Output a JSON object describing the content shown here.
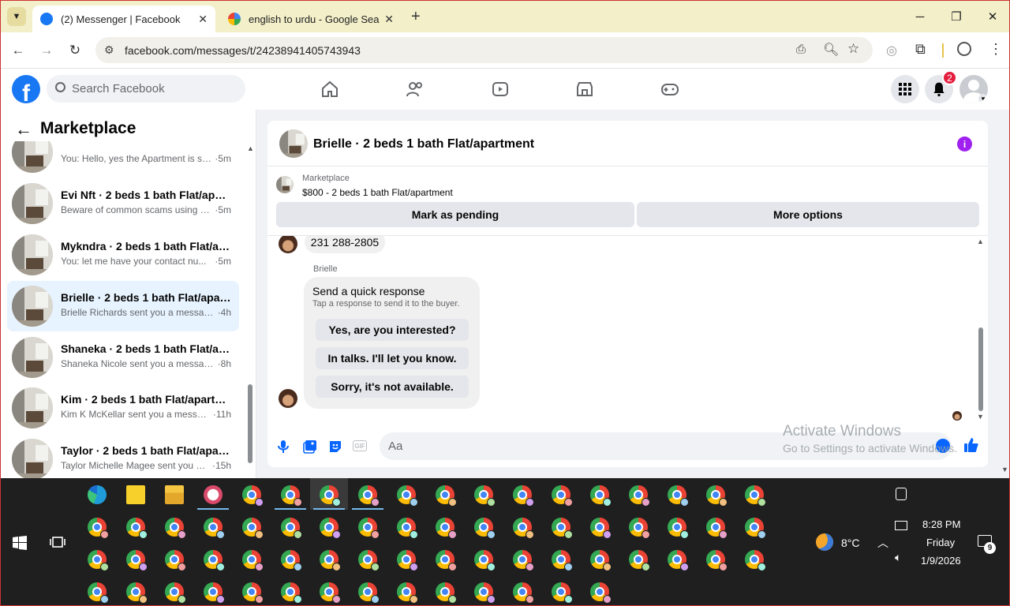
{
  "browser": {
    "tabs": [
      {
        "title": "(2) Messenger | Facebook",
        "active": true
      },
      {
        "title": "english to urdu - Google Search",
        "active": false
      }
    ],
    "url": "facebook.com/messages/t/24238941405743943"
  },
  "facebook": {
    "search_placeholder": "Search Facebook",
    "notification_count": "2"
  },
  "left_pane": {
    "title": "Marketplace",
    "conversations": [
      {
        "title": "",
        "preview": "You: Hello, yes the Apartment is sti...",
        "time": "·5m"
      },
      {
        "title": "Evi Nft · 2 beds 1 bath Flat/apart...",
        "preview": "Beware of common scams using p...",
        "time": "·5m"
      },
      {
        "title": "Mykndra · 2 beds 1 bath Flat/ap...",
        "preview": "You: let me have your contact nu...",
        "time": "·5m"
      },
      {
        "title": "Brielle · 2 beds 1 bath Flat/apart...",
        "preview": "Brielle Richards sent you a messag...",
        "time": "·4h",
        "selected": true
      },
      {
        "title": "Shaneka · 2 beds 1 bath Flat/apa...",
        "preview": "Shaneka Nicole sent you a messag...",
        "time": "·8h"
      },
      {
        "title": "Kim · 2 beds 1 bath Flat/apartm...",
        "preview": "Kim K McKellar sent you a messag...",
        "time": "·11h"
      },
      {
        "title": "Taylor · 2 beds 1 bath Flat/apart...",
        "preview": "Taylor Michelle Magee sent you a ...",
        "time": "·15h"
      }
    ]
  },
  "chat": {
    "header_title": "Brielle · 2 beds 1 bath Flat/apartment",
    "listing_label": "Marketplace",
    "listing_title": "$800 - 2 beds 1 bath Flat/apartment",
    "mark_pending_label": "Mark as pending",
    "more_options_label": "More options",
    "phone_message": "231 288-2805",
    "sender_name": "Brielle",
    "quick_response_title": "Send a quick response",
    "quick_response_subtitle": "Tap a response to send it to the buyer.",
    "quick_responses": [
      "Yes, are you interested?",
      "In talks. I'll let you know.",
      "Sorry, it's not available."
    ],
    "composer_placeholder": "Aa"
  },
  "watermark": {
    "line1": "Activate Windows",
    "line2": "Go to Settings to activate Windows."
  },
  "system_tray": {
    "weather": "8°C",
    "time": "8:28 PM",
    "day": "Friday",
    "date": "1/9/2026",
    "notifications": "9"
  },
  "colors": {
    "fb_blue": "#1877f2",
    "selected_row": "#e7f3ff",
    "info_purple": "#a020f0",
    "notification_red": "#e41e3f",
    "taskbar": "#1f1f1f"
  }
}
